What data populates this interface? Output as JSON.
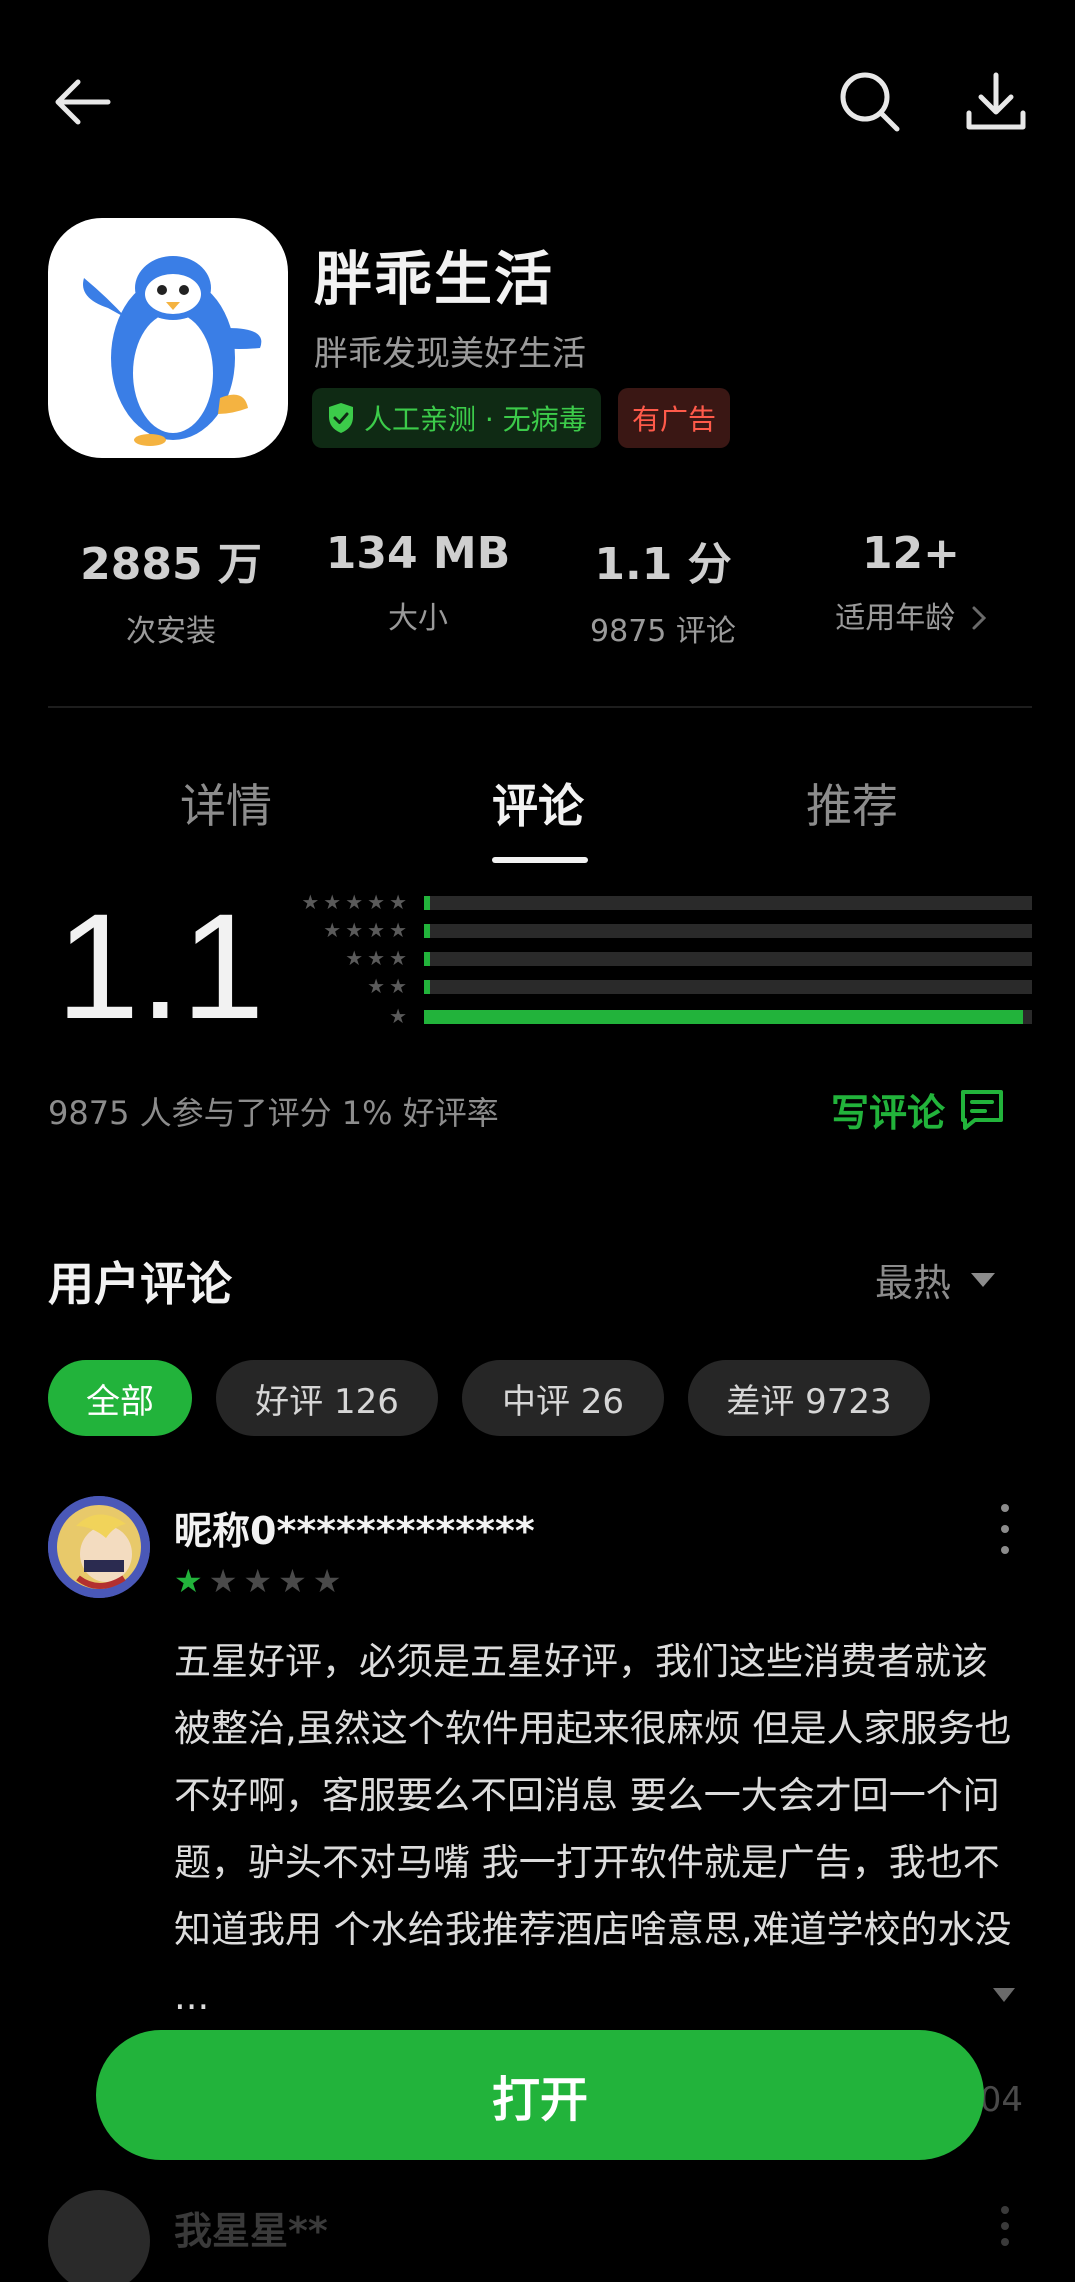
{
  "topbar": {
    "back_icon": "arrow-left-icon",
    "search_icon": "search-icon",
    "download_icon": "download-icon"
  },
  "app": {
    "name": "胖乖生活",
    "subtitle": "胖乖发现美好生活",
    "safety_tag": "人工亲测 · 无病毒",
    "ad_tag": "有广告"
  },
  "stats": [
    {
      "value": "2885 万",
      "label": "次安装"
    },
    {
      "value": "134 MB",
      "label": "大小"
    },
    {
      "value": "1.1 分",
      "label": "9875 评论"
    },
    {
      "value": "12+",
      "label": "适用年龄"
    }
  ],
  "tabs": [
    "详情",
    "评论",
    "推荐"
  ],
  "active_tab": "评论",
  "rating": {
    "score": "1.1",
    "distribution": [
      {
        "stars": 5,
        "fraction": 0.01
      },
      {
        "stars": 4,
        "fraction": 0.01
      },
      {
        "stars": 3,
        "fraction": 0.01
      },
      {
        "stars": 2,
        "fraction": 0.01
      },
      {
        "stars": 1,
        "fraction": 0.985
      }
    ],
    "summary": "9875 人参与了评分   1% 好评率",
    "write_review": "写评论"
  },
  "reviews_section": {
    "title": "用户评论",
    "sort": "最热",
    "filters": [
      {
        "label": "全部",
        "active": true
      },
      {
        "label": "好评 126",
        "active": false
      },
      {
        "label": "中评 26",
        "active": false
      },
      {
        "label": "差评 9723",
        "active": false
      }
    ]
  },
  "reviews": [
    {
      "name": "昵称0*************",
      "rating": 1,
      "text": "五星好评，必须是五星好评，我们这些消费者就该被整治,虽然这个软件用起来很麻烦 但是人家服务也不好啊，客服要么不回消息 要么一大会才回一个问题，驴头不对马嘴 我一打开软件就是广告，我也不知道我用 个水给我推荐酒店啥意思,难道学校的水没 ...",
      "date_fragment": "04"
    },
    {
      "name": "我星星**"
    }
  ],
  "open_button": "打开",
  "colors": {
    "accent": "#22b33b",
    "background": "#000000",
    "ad_red": "#ff5a4a"
  }
}
